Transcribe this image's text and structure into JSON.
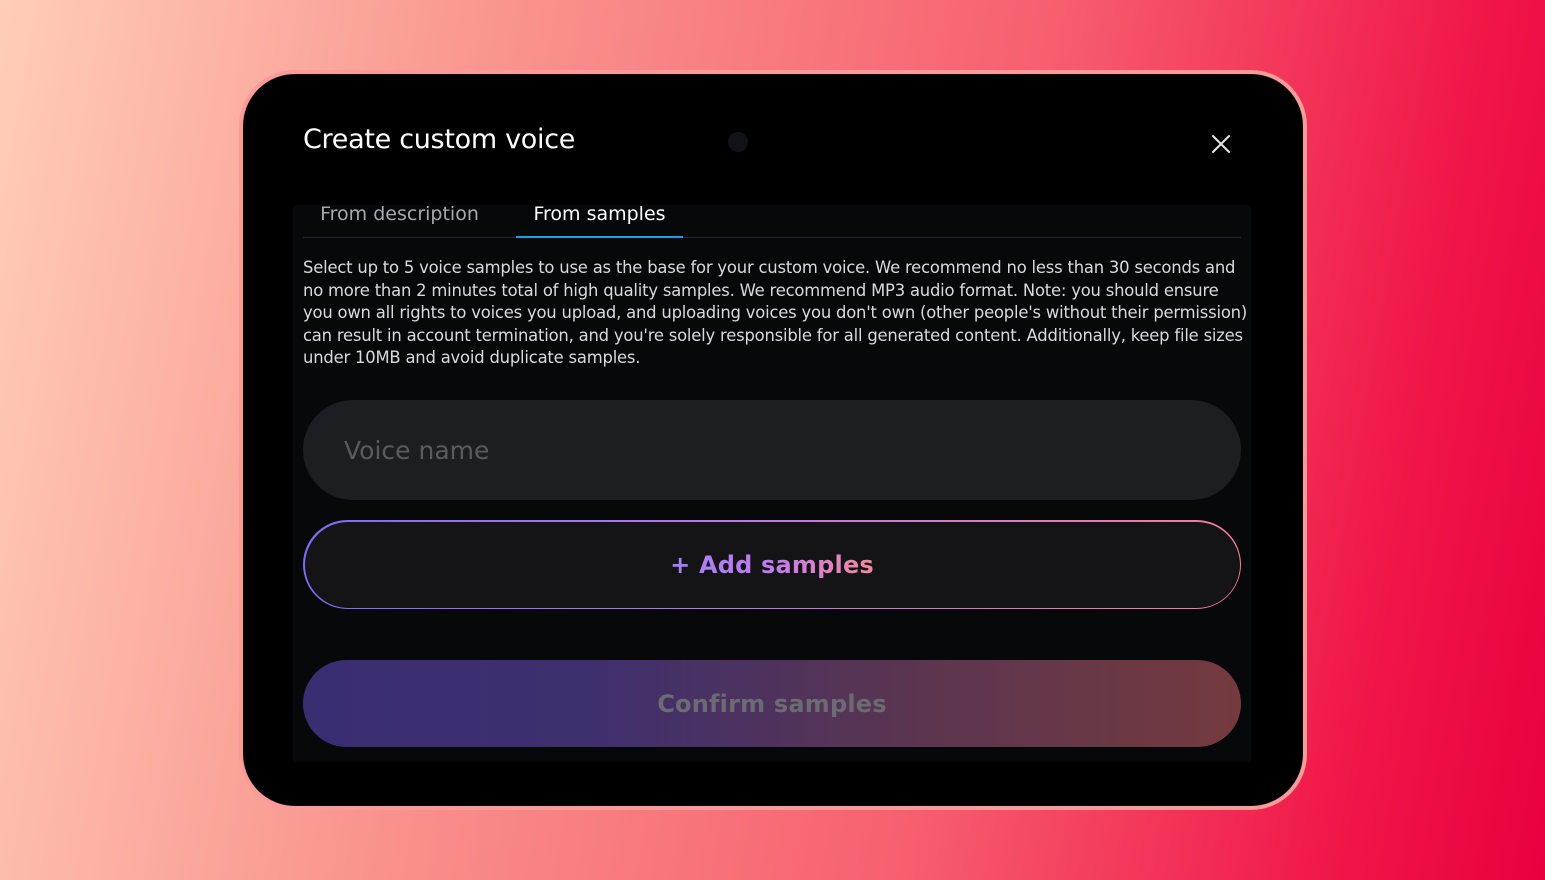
{
  "modal": {
    "title": "Create custom voice",
    "tabs": [
      {
        "label": "From description",
        "active": false
      },
      {
        "label": "From samples",
        "active": true
      }
    ],
    "description": "Select up to 5 voice samples to use as the base for your custom voice. We recommend no less than 30 seconds and no more than 2 minutes total of high quality samples. We recommend MP3 audio format. Note: you should ensure you own all rights to voices you upload, and uploading voices you don't own (other people's without their permission) can result in account termination, and you're solely responsible for all generated content. Additionally, keep file sizes under 10MB and avoid duplicate samples.",
    "voice_name": {
      "value": "",
      "placeholder": "Voice name"
    },
    "add_samples_label": "+ Add samples",
    "confirm_label": "Confirm samples",
    "confirm_enabled": false
  },
  "icons": {
    "close": "close-icon"
  },
  "colors": {
    "tab_active_underline": "#1aa0e8",
    "modal_background": "#000000",
    "input_background": "#1d1e21",
    "frame_border": "#f99b98"
  }
}
